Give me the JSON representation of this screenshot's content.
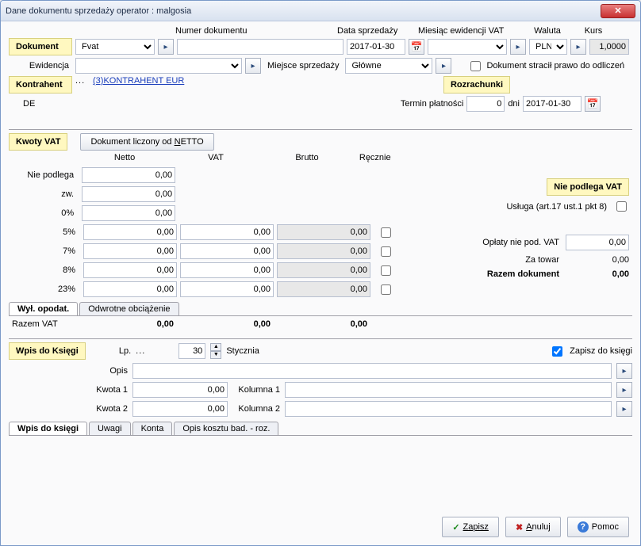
{
  "title": "Dane dokumentu sprzedaży    operator : malgosia",
  "header": {
    "numer_label": "Numer dokumentu",
    "data_label": "Data sprzedaży",
    "miesiac_label": "Miesiąc ewidencji VAT",
    "waluta_label": "Waluta",
    "kurs_label": "Kurs"
  },
  "dokument": {
    "label": "Dokument",
    "type": "Fvat",
    "numer": "",
    "data": "2017-01-30",
    "miesiac": "",
    "waluta": "PLN",
    "kurs": "1,0000"
  },
  "ewidencja": {
    "label": "Ewidencja",
    "value": "",
    "miejsce_label": "Miejsce sprzedaży",
    "miejsce_value": "Główne",
    "stracil_label": "Dokument stracił prawo do odliczeń"
  },
  "kontrahent": {
    "label": "Kontrahent",
    "dots": "...",
    "link": "(3)KONTRAHENT EUR",
    "kraj": "DE"
  },
  "rozrachunki": {
    "label": "Rozrachunki",
    "termin_label": "Termin płatności",
    "termin_dni": "0",
    "dni_label": "dni",
    "termin_data": "2017-01-30"
  },
  "kwoty": {
    "label": "Kwoty VAT",
    "netto_btn": "Dokument liczony od NETTO",
    "right_label": "Nie podlega VAT",
    "usluga_label": "Usługa (art.17 ust.1 pkt 8)",
    "col_netto": "Netto",
    "col_vat": "VAT",
    "col_brutto": "Brutto",
    "col_recznie": "Ręcznie",
    "rows": [
      {
        "rate": "Nie podlega",
        "netto": "0,00",
        "vat": "",
        "brutto": "",
        "manual": false,
        "full": false
      },
      {
        "rate": "zw.",
        "netto": "0,00",
        "vat": "",
        "brutto": "",
        "manual": false,
        "full": false
      },
      {
        "rate": "0%",
        "netto": "0,00",
        "vat": "",
        "brutto": "",
        "manual": false,
        "full": false
      },
      {
        "rate": "5%",
        "netto": "0,00",
        "vat": "0,00",
        "brutto": "0,00",
        "manual": false,
        "full": true
      },
      {
        "rate": "7%",
        "netto": "0,00",
        "vat": "0,00",
        "brutto": "0,00",
        "manual": false,
        "full": true
      },
      {
        "rate": "8%",
        "netto": "0,00",
        "vat": "0,00",
        "brutto": "0,00",
        "manual": false,
        "full": true
      },
      {
        "rate": "23%",
        "netto": "0,00",
        "vat": "0,00",
        "brutto": "0,00",
        "manual": false,
        "full": true
      }
    ],
    "oplaty_label": "Opłaty nie pod. VAT",
    "oplaty_value": "0,00",
    "zatowar_label": "Za towar",
    "zatowar_value": "0,00",
    "razem_label": "Razem dokument",
    "razem_value": "0,00",
    "tabs": [
      {
        "label": "Wył. opodat.",
        "active": true
      },
      {
        "label": "Odwrotne obciążenie",
        "active": false
      }
    ],
    "razem_vat_label": "Razem VAT",
    "sum_netto": "0,00",
    "sum_vat": "0,00",
    "sum_brutto": "0,00"
  },
  "wpis": {
    "label": "Wpis do Księgi",
    "lp_label": "Lp.",
    "lp_dots": "...",
    "day": "30",
    "month": "Stycznia",
    "zapisz_check": "Zapisz do księgi",
    "opis_label": "Opis",
    "opis_value": "",
    "kwota1_label": "Kwota 1",
    "kwota1_value": "0,00",
    "kolumna1_label": "Kolumna 1",
    "kolumna1_value": "",
    "kwota2_label": "Kwota 2",
    "kwota2_value": "0,00",
    "kolumna2_label": "Kolumna 2",
    "kolumna2_value": "",
    "tabs": [
      {
        "label": "Wpis do księgi",
        "active": true
      },
      {
        "label": "Uwagi",
        "active": false
      },
      {
        "label": "Konta",
        "active": false
      },
      {
        "label": "Opis kosztu bad. - roz.",
        "active": false
      }
    ]
  },
  "footer": {
    "zapisz": "Zapisz",
    "anuluj": "Anuluj",
    "pomoc": "Pomoc"
  }
}
